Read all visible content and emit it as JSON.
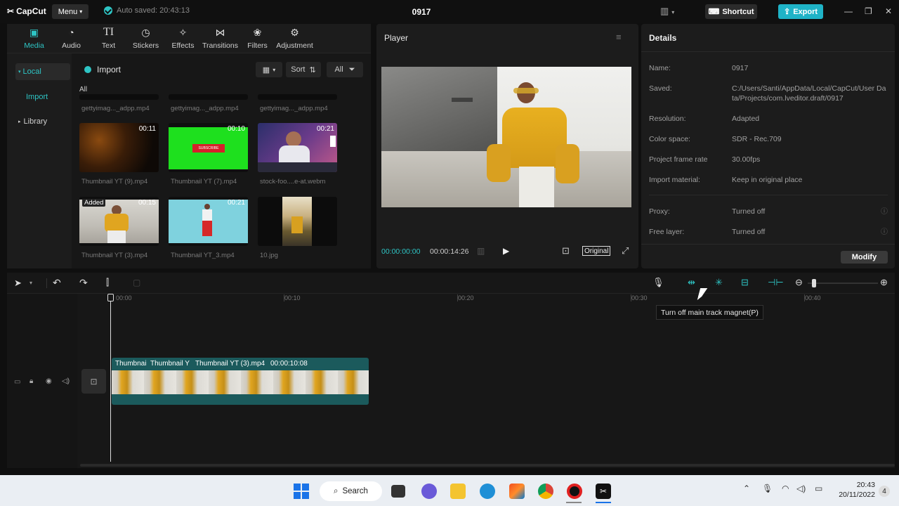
{
  "app": {
    "logo": "CapCut",
    "menu_label": "Menu",
    "autosave": "Auto saved: 20:43:13",
    "project_title": "0917",
    "shortcut_label": "Shortcut",
    "export_label": "Export"
  },
  "media_tabs": [
    {
      "label": "Media",
      "icon": "media-icon",
      "active": true
    },
    {
      "label": "Audio",
      "icon": "audio-icon"
    },
    {
      "label": "Text",
      "icon": "text-icon"
    },
    {
      "label": "Stickers",
      "icon": "stickers-icon"
    },
    {
      "label": "Effects",
      "icon": "effects-icon"
    },
    {
      "label": "Transitions",
      "icon": "transitions-icon"
    },
    {
      "label": "Filters",
      "icon": "filters-icon"
    },
    {
      "label": "Adjustment",
      "icon": "adjustment-icon"
    }
  ],
  "left_nav": {
    "local": "Local",
    "import": "Import",
    "library": "Library"
  },
  "media_toolbar": {
    "import_label": "Import",
    "sort_label": "Sort",
    "filter_label": "All",
    "section_label": "All"
  },
  "media_items": {
    "row0": [
      "gettyimag..._adpp.mp4",
      "gettyimag..._adpp.mp4",
      "gettyimag..._adpp.mp4"
    ],
    "row1": [
      {
        "name": "Thumbnail YT (9).mp4",
        "duration": "00:11"
      },
      {
        "name": "Thumbnail YT (7).mp4",
        "duration": "00:10"
      },
      {
        "name": "stock-foo....e-at.webm",
        "duration": "00:21"
      }
    ],
    "row2": [
      {
        "name": "Thumbnail YT (3).mp4",
        "duration": "00:15",
        "badge": "Added"
      },
      {
        "name": "Thumbnail YT_3.mp4",
        "duration": "00:21"
      },
      {
        "name": "10.jpg",
        "duration": ""
      }
    ],
    "subscribe_text": "SUBSCRIBE"
  },
  "player": {
    "title": "Player",
    "current_time": "00:00:00:00",
    "total_time": "00:00:14:26",
    "original_label": "Original"
  },
  "details": {
    "title": "Details",
    "rows": [
      {
        "label": "Name:",
        "value": "0917"
      },
      {
        "label": "Saved:",
        "value": "C:/Users/Santi/AppData/Local/CapCut/User Data/Projects/com.lveditor.draft/0917"
      },
      {
        "label": "Resolution:",
        "value": "Adapted"
      },
      {
        "label": "Color space:",
        "value": "SDR - Rec.709"
      },
      {
        "label": "Project frame rate",
        "value": "30.00fps"
      },
      {
        "label": "Import material:",
        "value": "Keep in original place"
      },
      {
        "label": "Proxy:",
        "value": "Turned off"
      },
      {
        "label": "Free layer:",
        "value": "Turned off"
      }
    ],
    "modify_label": "Modify"
  },
  "timeline": {
    "ruler": [
      "00:00",
      "00:10",
      "00:20",
      "00:30",
      "00:40"
    ],
    "tooltip": "Turn off main track magnet(P)",
    "clip": {
      "label1": "Thumbnai",
      "label2": "Thumbnail Y",
      "label3": "Thumbnail YT (3).mp4",
      "duration": "00:00:10:08"
    }
  },
  "taskbar": {
    "search_label": "Search",
    "time": "20:43",
    "date": "20/11/2022",
    "notification_count": "4"
  },
  "colors": {
    "accent": "#2ec5c5",
    "export": "#1fb3c7",
    "panel": "#1c1c1c",
    "clip": "#1b5a5c"
  }
}
